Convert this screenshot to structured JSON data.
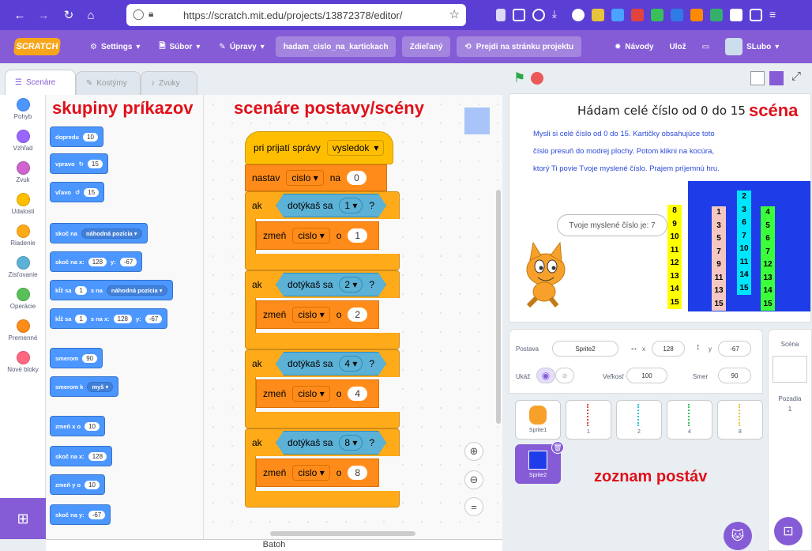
{
  "browser": {
    "url": "https://scratch.mit.edu/projects/13872378/editor/"
  },
  "menubar": {
    "logo": "SCRATCH",
    "settings": "Settings",
    "file": "Súbor",
    "edit": "Úpravy",
    "project_title": "hadam_cislo_na_kartickach",
    "share": "Zdieľaný",
    "project_page": "Prejdi na stránku projektu",
    "tutorials": "Návody",
    "save": "Ulož",
    "user": "SLubo"
  },
  "tabs": {
    "code": "Scenáre",
    "costumes": "Kostýmy",
    "sounds": "Zvuky"
  },
  "categories": [
    {
      "label": "Pohyb",
      "color": "#4c97ff"
    },
    {
      "label": "Vzhľad",
      "color": "#9966ff"
    },
    {
      "label": "Zvuk",
      "color": "#cf63cf"
    },
    {
      "label": "Udalosti",
      "color": "#ffbf00"
    },
    {
      "label": "Riadenie",
      "color": "#ffab19"
    },
    {
      "label": "Zisťovanie",
      "color": "#5cb1d6"
    },
    {
      "label": "Operácie",
      "color": "#59c059"
    },
    {
      "label": "Premenné",
      "color": "#ff8c1a"
    },
    {
      "label": "Nové bloky",
      "color": "#ff6680"
    }
  ],
  "palette": {
    "move": "dopredu",
    "move_v": "10",
    "turn_right": "vpravo",
    "turn_right_v": "15",
    "turn_left": "vľavo",
    "turn_left_v": "15",
    "goto": "skoč na",
    "goto_dd": "náhodná pozícia",
    "gotoxy": "skoč na x:",
    "gotoxy_x": "128",
    "gotoxy_y_label": "y:",
    "gotoxy_y": "-67",
    "glide": "kĺž sa",
    "glide_v": "1",
    "glide_mid": "s na",
    "glide_dd": "náhodná pozícia",
    "glidexy": "kĺž sa",
    "glidexy_v": "1",
    "glidexy_mid": "s na x:",
    "glidexy_x": "128",
    "glidexy_y_label": "y:",
    "glidexy_y": "-67",
    "direction": "smerom",
    "direction_v": "90",
    "towards": "smerom k",
    "towards_dd": "myš",
    "changex": "zmeň x o",
    "changex_v": "10",
    "setx": "skoč na x:",
    "setx_v": "128",
    "changey": "zmeň y o",
    "changey_v": "10",
    "sety": "skoč na y:",
    "sety_v": "-67"
  },
  "script": {
    "hat": "pri prijatí správy",
    "hat_dd": "vysledok",
    "set": "nastav",
    "set_dd": "cislo",
    "set_mid": "na",
    "set_v": "0",
    "if_label": "ak",
    "touch_label": "dotýkaš sa",
    "q": "?",
    "change": "zmeň",
    "change_dd": "cislo",
    "change_mid": "o",
    "ifs": [
      {
        "touch": "1",
        "value": "1"
      },
      {
        "touch": "2",
        "value": "2"
      },
      {
        "touch": "4",
        "value": "4"
      },
      {
        "touch": "8",
        "value": "8"
      }
    ]
  },
  "annotations": {
    "categories": "skupiny príkazov",
    "scripts": "scenáre postavy/scény",
    "stage": "scéna",
    "sprites": "zoznam postáv"
  },
  "backpack": "Batoh",
  "stage": {
    "title": "Hádam celé číslo od 0 do 15",
    "instructions": [
      "Mysli si celé číslo od 0 do 15. Kartičky obsahujúce toto",
      "číslo presuň do modrej plochy. Potom klikni na kocúra,",
      "ktorý Ti povie Tvoje myslené číslo. Prajem príjemnú hru."
    ],
    "speech": "Tvoje myslené číslo je: 7",
    "cards": [
      {
        "color": "#ffff00",
        "numbers": [
          "8",
          "9",
          "10",
          "11",
          "12",
          "13",
          "14",
          "15"
        ]
      },
      {
        "color": "#f4c7c3",
        "numbers": [
          "1",
          "3",
          "5",
          "7",
          "9",
          "11",
          "13",
          "15"
        ]
      },
      {
        "color": "#00e5ff",
        "numbers": [
          "2",
          "3",
          "6",
          "7",
          "10",
          "11",
          "14",
          "15"
        ]
      },
      {
        "color": "#3cff3c",
        "numbers": [
          "4",
          "5",
          "6",
          "7",
          "12",
          "13",
          "14",
          "15"
        ]
      }
    ]
  },
  "sprite_info": {
    "sprite_label": "Postava",
    "sprite_name": "Sprite2",
    "x_label": "x",
    "x": "128",
    "y_label": "y",
    "y": "-67",
    "show_label": "Ukáž",
    "size_label": "Veľkosť",
    "size": "100",
    "dir_label": "Smer",
    "dir": "90"
  },
  "sprites": [
    "Sprite1",
    "1",
    "2",
    "4",
    "8",
    "Sprite2"
  ],
  "stage_pane": {
    "title": "Scéna",
    "backdrops_label": "Pozadia",
    "backdrops_count": "1"
  }
}
